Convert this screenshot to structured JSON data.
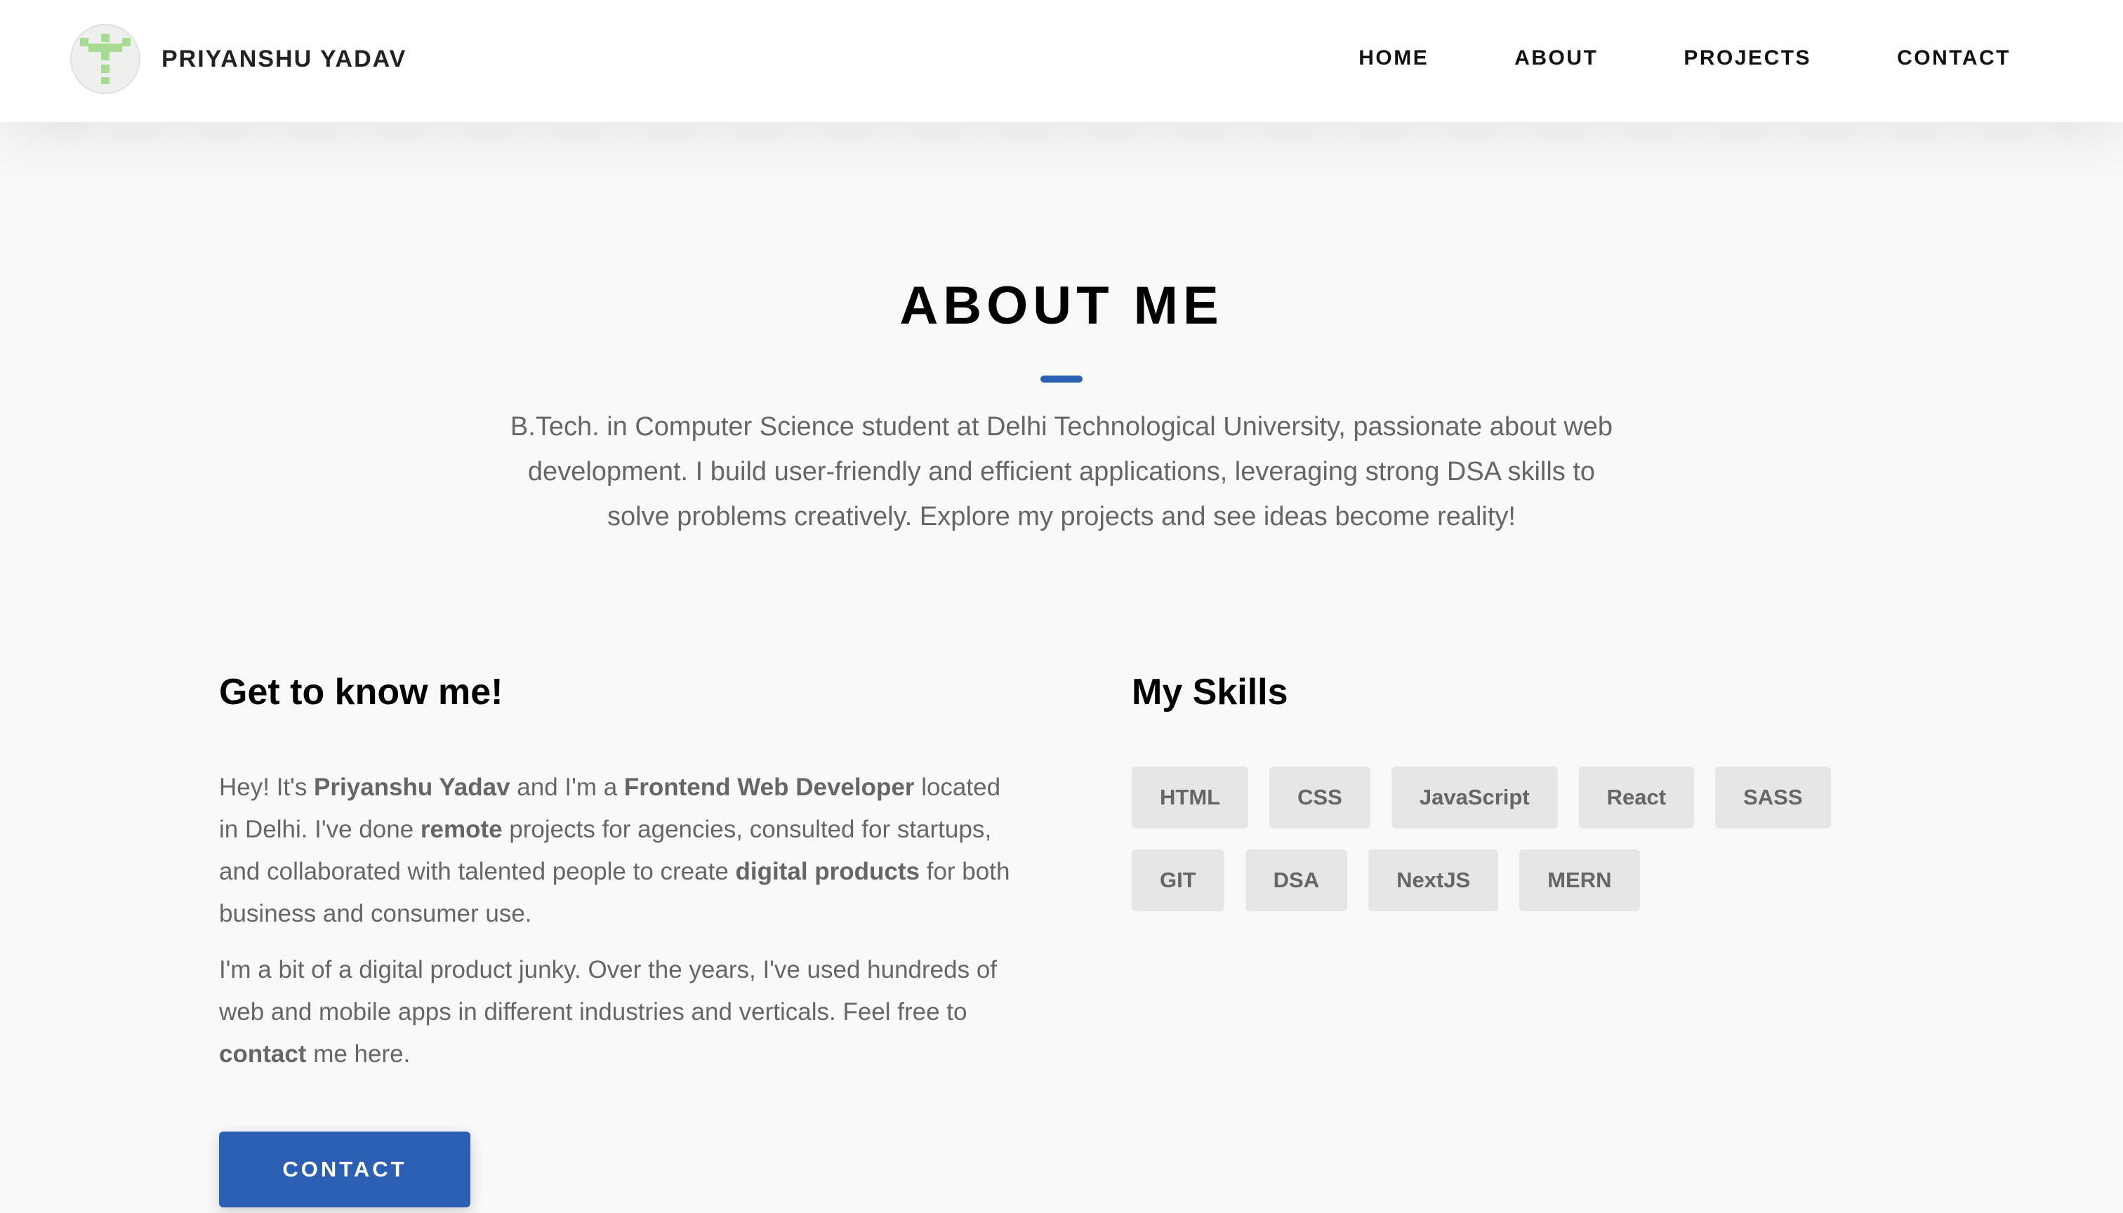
{
  "header": {
    "brand_name": "PRIYANSHU YADAV",
    "nav": [
      {
        "label": "HOME"
      },
      {
        "label": "ABOUT"
      },
      {
        "label": "PROJECTS"
      },
      {
        "label": "CONTACT"
      }
    ]
  },
  "about": {
    "title": "ABOUT ME",
    "intro": "B.Tech. in Computer Science student at Delhi Technological University, passionate about web development. I build user-friendly and efficient applications, leveraging strong DSA skills to solve problems creatively. Explore my projects and see ideas become reality!"
  },
  "know_me": {
    "heading": "Get to know me!",
    "para1": [
      "Hey! It's ",
      "Priyanshu Yadav",
      " and I'm a ",
      "Frontend Web Developer",
      " located in Delhi. I've done ",
      "remote",
      " projects for agencies, consulted for startups, and collaborated with talented people to create ",
      "digital products",
      " for both business and consumer use."
    ],
    "para2": [
      "I'm a bit of a digital product junky. Over the years, I've used hundreds of web and mobile apps in different industries and verticals. Feel free to ",
      "contact",
      " me here."
    ],
    "button_label": "CONTACT"
  },
  "skills": {
    "heading": "My Skills",
    "items": [
      "HTML",
      "CSS",
      "JavaScript",
      "React",
      "SASS",
      "GIT",
      "DSA",
      "NextJS",
      "MERN"
    ]
  },
  "colors": {
    "accent": "#2a5fb4",
    "background": "#f9f9f9",
    "header_bg": "#ffffff",
    "skill_bg": "#e6e6e6",
    "body_text": "#666666",
    "logo_green": "#9fd88a"
  },
  "icons": {
    "logo": "pixel-t-logo-icon"
  }
}
